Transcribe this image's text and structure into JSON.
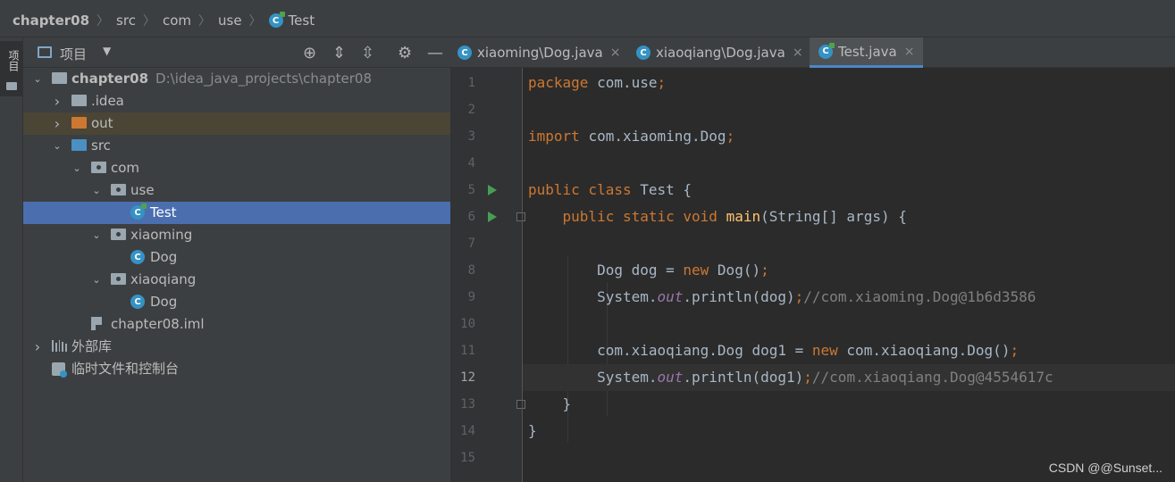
{
  "breadcrumbs": {
    "items": [
      "chapter08",
      "src",
      "com",
      "use",
      "Test"
    ],
    "icon": "java-class-icon"
  },
  "left_strip": {
    "project_tab_label": "项目"
  },
  "project_panel": {
    "title": "项目",
    "toolbar_icons": [
      "locate-icon",
      "expand-all-icon",
      "collapse-all-icon",
      "settings-icon",
      "hide-icon"
    ]
  },
  "tree": [
    {
      "label": "chapter08",
      "hint": "D:\\idea_java_projects\\chapter08",
      "level": 0,
      "expanded": true,
      "icon": "module-folder-icon"
    },
    {
      "label": ".idea",
      "level": 1,
      "expanded": false,
      "icon": "folder-icon"
    },
    {
      "label": "out",
      "level": 1,
      "expanded": false,
      "icon": "excluded-folder-icon"
    },
    {
      "label": "src",
      "level": 1,
      "expanded": true,
      "icon": "source-folder-icon"
    },
    {
      "label": "com",
      "level": 2,
      "expanded": true,
      "icon": "package-icon"
    },
    {
      "label": "use",
      "level": 3,
      "expanded": true,
      "icon": "package-icon"
    },
    {
      "label": "Test",
      "level": 4,
      "icon": "java-class-run-icon",
      "selected": true
    },
    {
      "label": "xiaoming",
      "level": 3,
      "expanded": true,
      "icon": "package-icon"
    },
    {
      "label": "Dog",
      "level": 4,
      "icon": "java-class-icon"
    },
    {
      "label": "xiaoqiang",
      "level": 3,
      "expanded": true,
      "icon": "package-icon"
    },
    {
      "label": "Dog",
      "level": 4,
      "icon": "java-class-icon"
    },
    {
      "label": "chapter08.iml",
      "level": 2,
      "icon": "iml-file-icon"
    },
    {
      "label": "外部库",
      "level": 0,
      "expanded": false,
      "icon": "libraries-icon"
    },
    {
      "label": "临时文件和控制台",
      "level": 0,
      "icon": "scratches-icon"
    }
  ],
  "editor_tabs": [
    {
      "label": "xiaoming\\Dog.java",
      "close": "×",
      "active": false
    },
    {
      "label": "xiaoqiang\\Dog.java",
      "close": "×",
      "active": false
    },
    {
      "label": "Test.java",
      "close": "×",
      "active": true
    }
  ],
  "line_numbers": [
    "1",
    "2",
    "3",
    "4",
    "5",
    "6",
    "7",
    "8",
    "9",
    "10",
    "11",
    "12",
    "13",
    "14",
    "15"
  ],
  "current_line": 12,
  "run_gutter_lines": [
    5,
    6
  ],
  "fold_lines": [
    6,
    13
  ],
  "code_lines": [
    [
      [
        "kw",
        "package "
      ],
      [
        "",
        "com.use"
      ],
      [
        "kw",
        ";"
      ]
    ],
    [],
    [
      [
        "kw",
        "import "
      ],
      [
        "",
        "com.xiaoming.Dog"
      ],
      [
        "kw",
        ";"
      ]
    ],
    [],
    [
      [
        "kw",
        "public class "
      ],
      [
        "",
        "Test {"
      ]
    ],
    [
      [
        "",
        "    "
      ],
      [
        "kw",
        "public static void "
      ],
      [
        "fn",
        "main"
      ],
      [
        "",
        "(String[] args) {"
      ]
    ],
    [],
    [
      [
        "",
        "        Dog dog = "
      ],
      [
        "kw",
        "new "
      ],
      [
        "",
        "Dog()"
      ],
      [
        "kw",
        ";"
      ]
    ],
    [
      [
        "",
        "        System."
      ],
      [
        "st",
        "out"
      ],
      [
        "",
        ".println(dog)"
      ],
      [
        "kw",
        ";"
      ],
      [
        "cm",
        "//com.xiaoming.Dog@1b6d3586"
      ]
    ],
    [],
    [
      [
        "",
        "        com.xiaoqiang.Dog dog1 = "
      ],
      [
        "kw",
        "new "
      ],
      [
        "",
        "com.xiaoqiang.Dog()"
      ],
      [
        "kw",
        ";"
      ]
    ],
    [
      [
        "",
        "        System."
      ],
      [
        "st",
        "out"
      ],
      [
        "",
        ".println(dog1)"
      ],
      [
        "kw",
        ";"
      ],
      [
        "cm",
        "//com.xiaoqiang.Dog@4554617c"
      ]
    ],
    [
      [
        "",
        "    }"
      ]
    ],
    [
      [
        "",
        "}"
      ]
    ],
    []
  ],
  "watermark": "CSDN @@Sunset...",
  "colors": {
    "keyword": "#cc7832",
    "method": "#ffc66d",
    "static_field": "#9876aa",
    "comment": "#808080",
    "selection": "#4b6eaf",
    "accent": "#4a88c7"
  }
}
